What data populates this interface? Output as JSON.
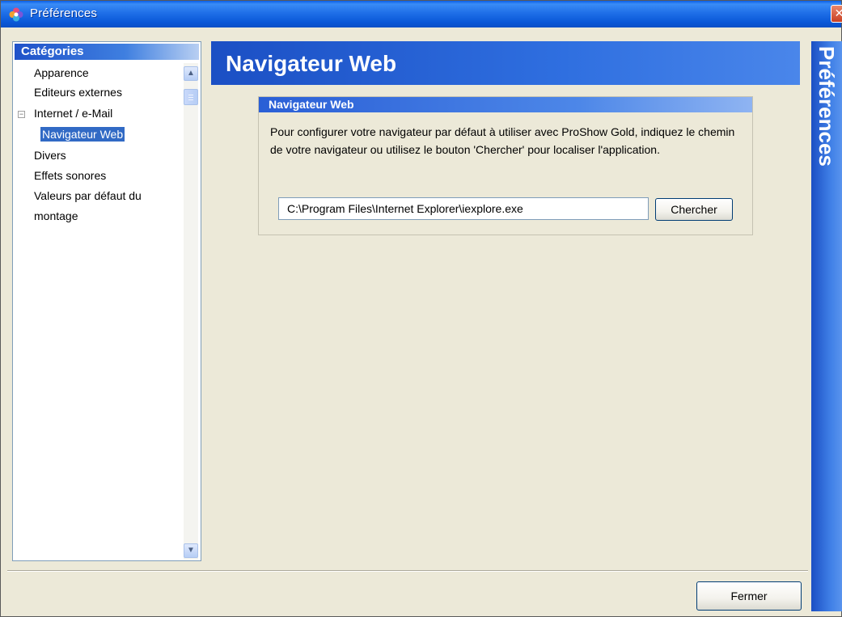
{
  "window": {
    "title": "Préférences"
  },
  "sidebar": {
    "header": "Catégories",
    "items": [
      {
        "label": "Apparence"
      },
      {
        "label": "Editeurs externes"
      },
      {
        "label": "Internet / e-Mail"
      },
      {
        "label": "Navigateur Web",
        "selected": true
      },
      {
        "label": "Divers"
      },
      {
        "label": "Effets sonores"
      },
      {
        "label": "Valeurs par défaut du"
      },
      {
        "label": "montage"
      }
    ]
  },
  "main": {
    "title": "Navigateur Web",
    "side_title": "Préférences",
    "group": {
      "title": "Navigateur Web",
      "description": "Pour configurer votre navigateur par défaut à utiliser avec ProShow Gold, indiquez le chemin de votre navigateur ou utilisez le bouton 'Chercher' pour localiser l'application.",
      "path_value": "C:\\Program Files\\Internet Explorer\\iexplore.exe",
      "search_label": "Chercher"
    }
  },
  "footer": {
    "close_label": "Fermer"
  },
  "icons": {
    "app": "flower-icon",
    "close": "close-icon",
    "scroll_up": "chevron-up-icon",
    "scroll_down": "chevron-down-icon",
    "collapse": "minus-box-icon"
  },
  "colors": {
    "accent_blue": "#316ac5",
    "titlebar_blue": "#0a58d8",
    "panel_bg": "#ece9d8"
  }
}
